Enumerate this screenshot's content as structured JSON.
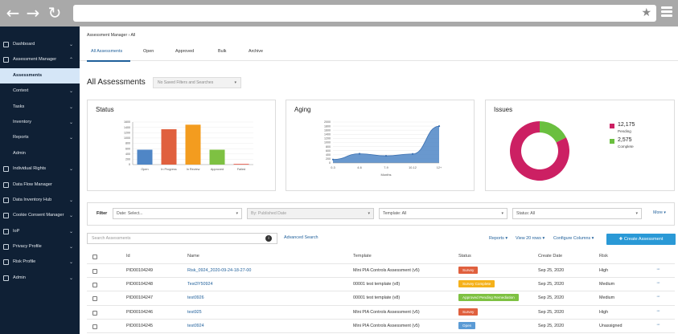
{
  "browser": {
    "back_icon": "back-arrow-icon",
    "forward_icon": "forward-arrow-icon",
    "reload_icon": "reload-icon",
    "bookmark_icon": "star-icon",
    "menu_icon": "hamburger-icon"
  },
  "sidebar": {
    "items": [
      {
        "label": "Dashboard"
      },
      {
        "label": "Assessment Manager"
      },
      {
        "label": "Assessments"
      },
      {
        "label": "Context"
      },
      {
        "label": "Tasks"
      },
      {
        "label": "Inventory"
      },
      {
        "label": "Reports"
      },
      {
        "label": "Admin"
      },
      {
        "label": "Individual Rights"
      },
      {
        "label": "Data Flow Manager"
      },
      {
        "label": "Data Inventory Hub"
      },
      {
        "label": "Cookie Consent Manager"
      },
      {
        "label": "IoP"
      },
      {
        "label": "Privacy Profile"
      },
      {
        "label": "Risk Profile"
      },
      {
        "label": "Admin"
      }
    ]
  },
  "breadcrumb": {
    "parent": "Assessment Manager",
    "separator": "›",
    "current": "All"
  },
  "tabs": [
    "All Assessments",
    "Open",
    "Approved",
    "Bulk",
    "Archive"
  ],
  "page": {
    "title": "All Assessments",
    "saved_filter_placeholder": "No Saved Filters and Searches"
  },
  "cards": {
    "status_title": "Status",
    "aging_title": "Aging",
    "issues_title": "Issues"
  },
  "chart_data": [
    {
      "type": "bar",
      "title": "Status",
      "categories": [
        "Open",
        "In Progress",
        "In Review",
        "Approved",
        "Failed"
      ],
      "values": [
        560,
        1330,
        1500,
        560,
        20
      ],
      "colors": [
        "#4f86c6",
        "#e0603e",
        "#f39c1f",
        "#7ec142",
        "#e74c3c"
      ],
      "ylim": [
        0,
        1600
      ],
      "yticks": [
        0,
        200,
        400,
        600,
        800,
        1000,
        1200,
        1400,
        1600
      ]
    },
    {
      "type": "area",
      "title": "Aging",
      "xlabel": "Months",
      "categories": [
        "0-3",
        "4-6",
        "7-9",
        "10-12",
        "12+"
      ],
      "values": [
        170,
        450,
        350,
        440,
        1800
      ],
      "color": "#4f86c6",
      "ylim": [
        0,
        2000
      ],
      "yticks": [
        0,
        200,
        400,
        600,
        800,
        1000,
        1200,
        1400,
        1600,
        1800,
        2000
      ]
    },
    {
      "type": "pie",
      "title": "Issues",
      "donut": true,
      "slices": [
        {
          "label": "Pending",
          "value": 12175,
          "display": "12,175",
          "color": "#cc2063"
        },
        {
          "label": "Complete",
          "value": 2575,
          "display": "2,575",
          "color": "#6abf3f"
        }
      ]
    }
  ],
  "filter": {
    "label": "Filter",
    "date_placeholder": "Date: Select...",
    "published_placeholder": "By: Published Date",
    "template_value": "Template: All",
    "status_value": "Status: All",
    "more_label": "More"
  },
  "toolbar": {
    "search_placeholder": "Search Assessments",
    "advanced_search": "Advanced Search",
    "reports": "Reports",
    "rows": "View 20 rows",
    "configure": "Configure Columns",
    "create": "Create Assessment"
  },
  "table": {
    "headers": [
      "Id",
      "Name",
      "Template",
      "Status",
      "Create Date",
      "Risk"
    ],
    "rows": [
      {
        "id": "PID00104249",
        "name": "Risk_0924_2020-09-24-18-27-00",
        "template": "Mini PIA Controls Assessment (v5)",
        "status": "Survey",
        "status_color": "#e0603e",
        "date": "Sep 25, 2020",
        "risk": "High"
      },
      {
        "id": "PID00104248",
        "name": "Test3Y50924",
        "template": "00001 test template (v8)",
        "status": "Survey Complete",
        "status_color": "#f5b11b",
        "date": "Sep 25, 2020",
        "risk": "Medium"
      },
      {
        "id": "PID00104247",
        "name": "test0926",
        "template": "00001 test template (v8)",
        "status": "Approved Pending Remediation",
        "status_color": "#7ec142",
        "date": "Sep 25, 2020",
        "risk": "Medium"
      },
      {
        "id": "PID00104246",
        "name": "test925",
        "template": "Mini PIA Controls Assessment (v5)",
        "status": "Survey",
        "status_color": "#e0603e",
        "date": "Sep 25, 2020",
        "risk": "High"
      },
      {
        "id": "PID00104245",
        "name": "test0924",
        "template": "Mini PIA Controls Assessment (v5)",
        "status": "Open",
        "status_color": "#5b9bd5",
        "date": "Sep 25, 2020",
        "risk": "Unassigned"
      }
    ]
  }
}
